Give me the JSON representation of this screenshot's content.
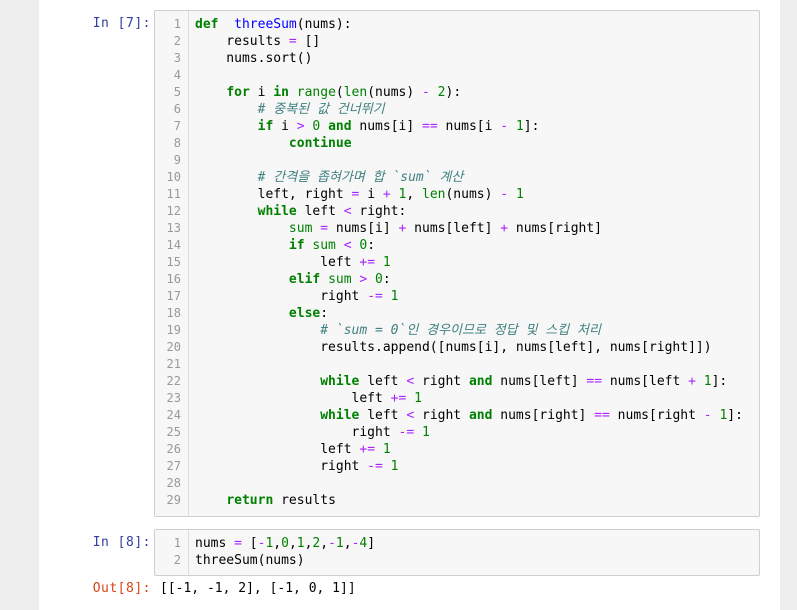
{
  "cells": [
    {
      "prompt": "In [7]:",
      "lines": [
        [
          [
            "kw",
            "def"
          ],
          [
            "",
            "  "
          ],
          [
            "fn",
            "threeSum"
          ],
          [
            "",
            "(nums):"
          ]
        ],
        [
          [
            "",
            "    results "
          ],
          [
            "op",
            "="
          ],
          [
            "",
            " []"
          ]
        ],
        [
          [
            "",
            "    nums.sort()"
          ]
        ],
        [
          [
            "",
            ""
          ]
        ],
        [
          [
            "",
            "    "
          ],
          [
            "kw",
            "for"
          ],
          [
            "",
            " i "
          ],
          [
            "kw",
            "in"
          ],
          [
            "",
            " "
          ],
          [
            "bi",
            "range"
          ],
          [
            "",
            "("
          ],
          [
            "bi",
            "len"
          ],
          [
            "",
            "(nums) "
          ],
          [
            "op",
            "-"
          ],
          [
            "",
            " "
          ],
          [
            "num",
            "2"
          ],
          [
            "",
            "):"
          ]
        ],
        [
          [
            "",
            "        "
          ],
          [
            "cm",
            "# 중복된 값 건너뛰기"
          ]
        ],
        [
          [
            "",
            "        "
          ],
          [
            "kw",
            "if"
          ],
          [
            "",
            " i "
          ],
          [
            "op",
            ">"
          ],
          [
            "",
            " "
          ],
          [
            "num",
            "0"
          ],
          [
            "",
            " "
          ],
          [
            "kw",
            "and"
          ],
          [
            "",
            " nums[i] "
          ],
          [
            "op",
            "=="
          ],
          [
            "",
            " nums[i "
          ],
          [
            "op",
            "-"
          ],
          [
            "",
            " "
          ],
          [
            "num",
            "1"
          ],
          [
            "",
            "]:"
          ]
        ],
        [
          [
            "",
            "            "
          ],
          [
            "kw",
            "continue"
          ]
        ],
        [
          [
            "",
            ""
          ]
        ],
        [
          [
            "",
            "        "
          ],
          [
            "cm",
            "# 간격을 좁혀가며 합 `sum` 계산"
          ]
        ],
        [
          [
            "",
            "        left, right "
          ],
          [
            "op",
            "="
          ],
          [
            "",
            " i "
          ],
          [
            "op",
            "+"
          ],
          [
            "",
            " "
          ],
          [
            "num",
            "1"
          ],
          [
            "",
            ", "
          ],
          [
            "bi",
            "len"
          ],
          [
            "",
            "(nums) "
          ],
          [
            "op",
            "-"
          ],
          [
            "",
            " "
          ],
          [
            "num",
            "1"
          ]
        ],
        [
          [
            "",
            "        "
          ],
          [
            "kw",
            "while"
          ],
          [
            "",
            " left "
          ],
          [
            "op",
            "<"
          ],
          [
            "",
            " right:"
          ]
        ],
        [
          [
            "",
            "            "
          ],
          [
            "bi",
            "sum"
          ],
          [
            "",
            " "
          ],
          [
            "op",
            "="
          ],
          [
            "",
            " nums[i] "
          ],
          [
            "op",
            "+"
          ],
          [
            "",
            " nums[left] "
          ],
          [
            "op",
            "+"
          ],
          [
            "",
            " nums[right]"
          ]
        ],
        [
          [
            "",
            "            "
          ],
          [
            "kw",
            "if"
          ],
          [
            "",
            " "
          ],
          [
            "bi",
            "sum"
          ],
          [
            "",
            " "
          ],
          [
            "op",
            "<"
          ],
          [
            "",
            " "
          ],
          [
            "num",
            "0"
          ],
          [
            "",
            ":"
          ]
        ],
        [
          [
            "",
            "                left "
          ],
          [
            "op",
            "+="
          ],
          [
            "",
            " "
          ],
          [
            "num",
            "1"
          ]
        ],
        [
          [
            "",
            "            "
          ],
          [
            "kw",
            "elif"
          ],
          [
            "",
            " "
          ],
          [
            "bi",
            "sum"
          ],
          [
            "",
            " "
          ],
          [
            "op",
            ">"
          ],
          [
            "",
            " "
          ],
          [
            "num",
            "0"
          ],
          [
            "",
            ":"
          ]
        ],
        [
          [
            "",
            "                right "
          ],
          [
            "op",
            "-="
          ],
          [
            "",
            " "
          ],
          [
            "num",
            "1"
          ]
        ],
        [
          [
            "",
            "            "
          ],
          [
            "kw",
            "else"
          ],
          [
            "",
            ":"
          ]
        ],
        [
          [
            "",
            "                "
          ],
          [
            "cm",
            "# `sum = 0`인 경우이므로 정답 및 스킵 처리"
          ]
        ],
        [
          [
            "",
            "                results.append([nums[i], nums[left], nums[right]])"
          ]
        ],
        [
          [
            "",
            ""
          ]
        ],
        [
          [
            "",
            "                "
          ],
          [
            "kw",
            "while"
          ],
          [
            "",
            " left "
          ],
          [
            "op",
            "<"
          ],
          [
            "",
            " right "
          ],
          [
            "kw",
            "and"
          ],
          [
            "",
            " nums[left] "
          ],
          [
            "op",
            "=="
          ],
          [
            "",
            " nums[left "
          ],
          [
            "op",
            "+"
          ],
          [
            "",
            " "
          ],
          [
            "num",
            "1"
          ],
          [
            "",
            "]:"
          ]
        ],
        [
          [
            "",
            "                    left "
          ],
          [
            "op",
            "+="
          ],
          [
            "",
            " "
          ],
          [
            "num",
            "1"
          ]
        ],
        [
          [
            "",
            "                "
          ],
          [
            "kw",
            "while"
          ],
          [
            "",
            " left "
          ],
          [
            "op",
            "<"
          ],
          [
            "",
            " right "
          ],
          [
            "kw",
            "and"
          ],
          [
            "",
            " nums[right] "
          ],
          [
            "op",
            "=="
          ],
          [
            "",
            " nums[right "
          ],
          [
            "op",
            "-"
          ],
          [
            "",
            " "
          ],
          [
            "num",
            "1"
          ],
          [
            "",
            "]:"
          ]
        ],
        [
          [
            "",
            "                    right "
          ],
          [
            "op",
            "-="
          ],
          [
            "",
            " "
          ],
          [
            "num",
            "1"
          ]
        ],
        [
          [
            "",
            "                left "
          ],
          [
            "op",
            "+="
          ],
          [
            "",
            " "
          ],
          [
            "num",
            "1"
          ]
        ],
        [
          [
            "",
            "                right "
          ],
          [
            "op",
            "-="
          ],
          [
            "",
            " "
          ],
          [
            "num",
            "1"
          ]
        ],
        [
          [
            "",
            ""
          ]
        ],
        [
          [
            "",
            "    "
          ],
          [
            "kw",
            "return"
          ],
          [
            "",
            " results"
          ]
        ]
      ]
    },
    {
      "prompt": "In [8]:",
      "lines": [
        [
          [
            "",
            "nums "
          ],
          [
            "op",
            "="
          ],
          [
            "",
            " ["
          ],
          [
            "op",
            "-"
          ],
          [
            "num",
            "1"
          ],
          [
            "",
            ","
          ],
          [
            "num",
            "0"
          ],
          [
            "",
            ","
          ],
          [
            "num",
            "1"
          ],
          [
            "",
            ","
          ],
          [
            "num",
            "2"
          ],
          [
            "",
            ","
          ],
          [
            "op",
            "-"
          ],
          [
            "num",
            "1"
          ],
          [
            "",
            ","
          ],
          [
            "op",
            "-"
          ],
          [
            "num",
            "4"
          ],
          [
            "",
            "]"
          ]
        ],
        [
          [
            "",
            "threeSum(nums)"
          ]
        ]
      ]
    }
  ],
  "output": {
    "prompt": "Out[8]:",
    "text": "[[-1, -1, 2], [-1, 0, 1]]"
  }
}
